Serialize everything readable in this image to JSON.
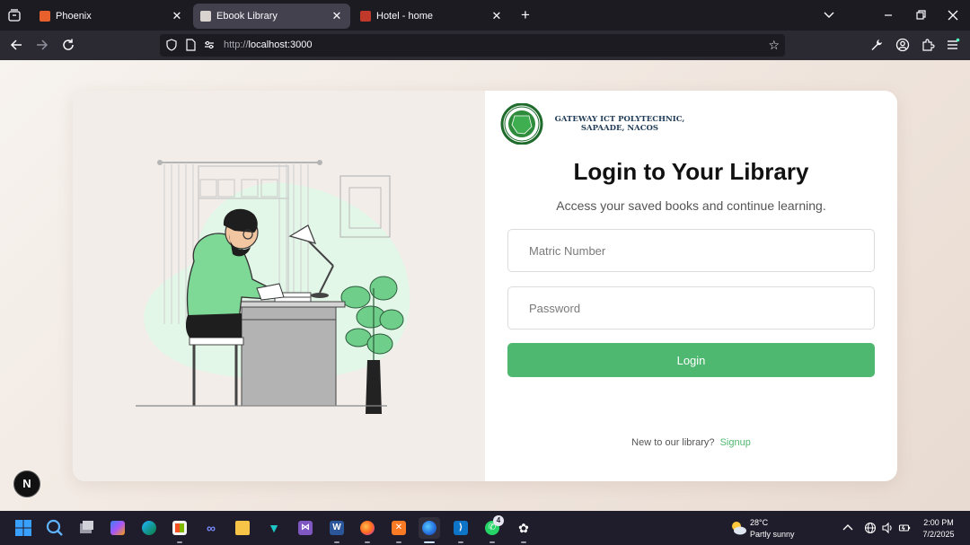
{
  "browser": {
    "tabs": [
      {
        "title": "Phoenix",
        "active": false,
        "favicon_color": "#e8612c"
      },
      {
        "title": "Ebook Library",
        "active": true,
        "favicon_color": "#d9d4cf"
      },
      {
        "title": "Hotel - home",
        "active": false,
        "favicon_color": "#c0392b"
      }
    ],
    "url_scheme": "http://",
    "url_host": "localhost:3000",
    "icons": [
      "tab-list-icon",
      "new-tab-icon",
      "chevron-down-icon",
      "minimize-icon",
      "restore-icon",
      "close-icon",
      "back-icon",
      "forward-icon",
      "reload-icon",
      "shield-icon",
      "page-icon",
      "permissions-icon",
      "bookmark-star-icon",
      "wrench-icon",
      "account-icon",
      "extensions-icon",
      "menu-icon"
    ]
  },
  "page": {
    "school_name_line1": "GATEWAY ICT POLYTECHNIC,",
    "school_name_line2": "SAPAADE, NACOS",
    "title": "Login to Your Library",
    "subtitle": "Access your saved books and continue learning.",
    "matric_placeholder": "Matric Number",
    "password_placeholder": "Password",
    "login_label": "Login",
    "signup_prompt": "New to our library?",
    "signup_link": "Signup",
    "dev_badge": "N",
    "accent_color": "#4fb870"
  },
  "taskbar": {
    "apps": [
      "windows-start",
      "search",
      "task-view",
      "copilot",
      "edge",
      "microsoft-store",
      "infinity-app",
      "file-explorer",
      "vpn-app",
      "visual-studio",
      "word",
      "firefox",
      "xampp",
      "firefox-developer",
      "vscode",
      "whatsapp",
      "chatgpt"
    ],
    "whatsapp_badge": "4",
    "weather_temp": "28°C",
    "weather_condition": "Partly sunny",
    "time": "2:00 PM",
    "date": "7/2/2025"
  }
}
